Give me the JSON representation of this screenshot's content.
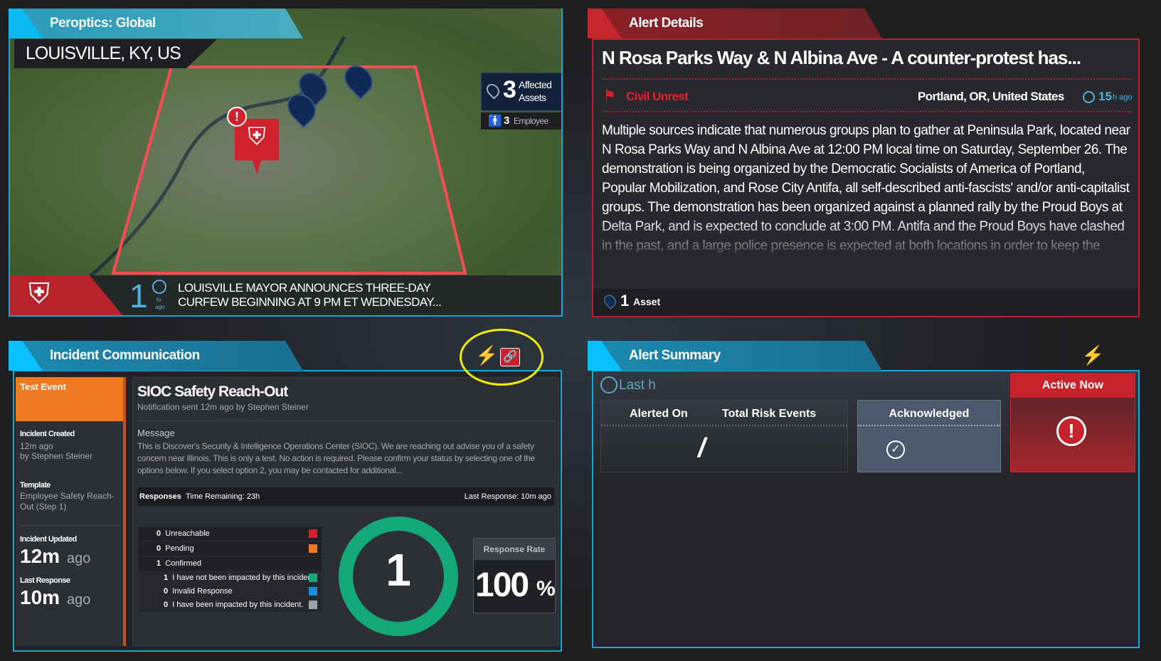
{
  "map_panel": {
    "title": "Peroptics: Global",
    "location": "LOUISVILLE, KY, US",
    "affected_count": "3",
    "affected_label_1": "Affected",
    "affected_label_2": "Assets",
    "employee_count": "3",
    "employee_label": "Employee",
    "news_time": "1",
    "news_time_unit": "hr",
    "news_time_suffix": "ago",
    "news_line_1": "LOUISVILLE MAYOR ANNOUNCES THREE-DAY",
    "news_line_2": "CURFEW BEGINNING AT 9 PM ET WEDNESDAY...",
    "colors": {
      "accent": "#18a8d8",
      "alert": "#d0222c",
      "asset_pin": "#0f2a55",
      "employee": "#f0931e"
    }
  },
  "alert_details": {
    "tab": "Alert Details",
    "headline": "N Rosa Parks Way & N Albina Ave - A counter-protest has...",
    "category": "Civil Unrest",
    "location": "Portland, OR, United States",
    "time": "15",
    "time_unit": "h ago",
    "body": "Multiple sources indicate that numerous groups plan to gather at Peninsula Park, located near N Rosa Parks Way and N Albina Ave at 12:00 PM local time on Saturday, September 26. The demonstration is being organized by the Democratic Socialists of America of Portland, Popular Mobilization, and Rose City Antifa, all self-described anti-fascists' and/or anti-capitalist groups. The demonstration has been organized against a planned rally by the Proud Boys at Delta Park, and is expected to conclude at 3:00 PM. Antifa and the Proud Boys have clashed in the past, and a large police presence is expected at both locations in order to keep the",
    "asset_count": "1",
    "asset_label": "Asset"
  },
  "incident": {
    "tab": "Incident Communication",
    "event_type": "Test Event",
    "created_label": "Incident Created",
    "created_value": "12m ago",
    "created_by": "by Stephen Steiner",
    "template_label": "Template",
    "template_value": "Employee Safety Reach-Out (Step 1)",
    "updated_label": "Incident Updated",
    "updated_value": "12m",
    "updated_suffix": "ago",
    "last_response_label": "Last Response",
    "last_response_value": "10m",
    "last_response_suffix": "ago",
    "title": "SIOC Safety Reach-Out",
    "sent": "Notification sent 12m ago by Stephen Steiner",
    "message_label": "Message",
    "message": "This is Discover's Security & Intelligence Operations Center (SIOC). We are reaching out advise you of a safety concern near Illinois. This is only a test. No action is required. Please confirm your status by selecting one of the options below. If you select option 2, you may be contacted for additional...",
    "responses_label": "Responses",
    "time_remaining": "Time Remaining: 23h",
    "last_response": "Last Response: 10m ago",
    "rows": [
      {
        "count": "0",
        "label": "Unreachable",
        "color": "#d0222c"
      },
      {
        "count": "0",
        "label": "Pending",
        "color": "#f07a22"
      },
      {
        "count": "1",
        "label": "Confirmed",
        "color": ""
      },
      {
        "count": "1",
        "label": "I have not been impacted by this incident.",
        "color": "#12a878"
      },
      {
        "count": "0",
        "label": "Invalid Response",
        "color": "#1a8fe0"
      },
      {
        "count": "0",
        "label": "I have been impacted by this incident.",
        "color": "#a0a4a8"
      }
    ],
    "donut_value": "1",
    "response_rate_label": "Response Rate",
    "response_rate": "100",
    "response_rate_unit": "%"
  },
  "summary": {
    "tab": "Alert Summary",
    "range": "Last h",
    "col1": "Alerted On",
    "col2": "Total Risk Events",
    "value": "/",
    "acknowledged": "Acknowledged",
    "active_now": "Active Now"
  }
}
